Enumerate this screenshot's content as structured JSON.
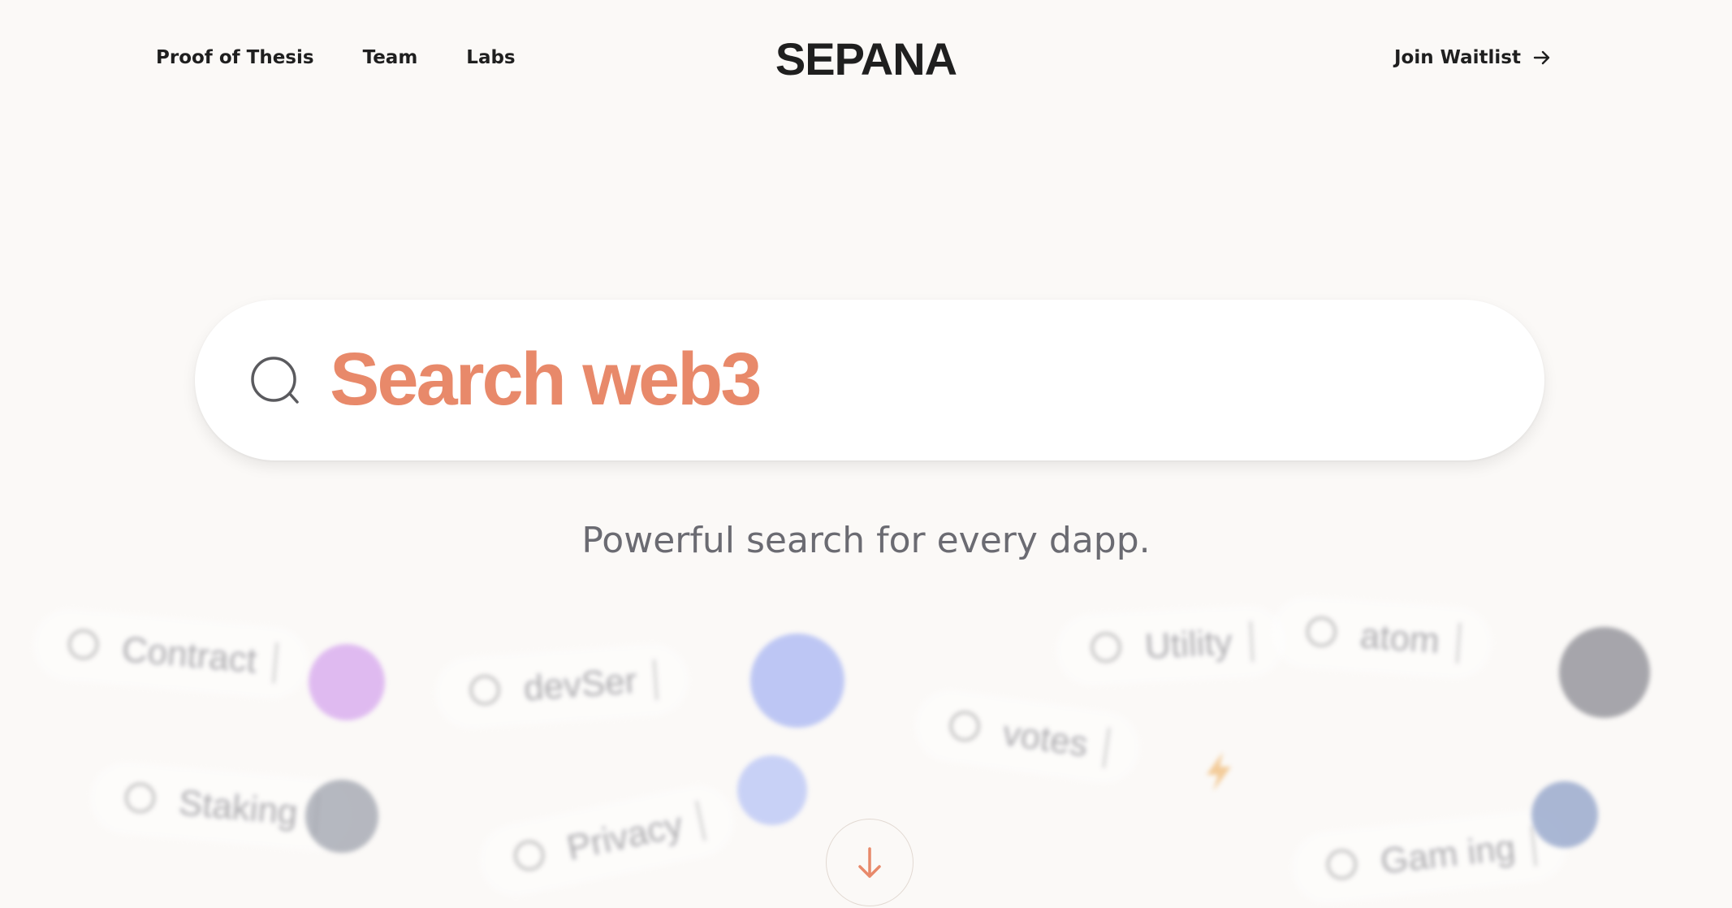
{
  "nav": {
    "links": [
      "Proof of Thesis",
      "Team",
      "Labs"
    ],
    "logo": "SEPANA",
    "cta": "Join Waitlist"
  },
  "hero": {
    "search_placeholder": "Search web3",
    "tagline": "Powerful search for every dapp."
  },
  "background_chips": [
    "Contract",
    "devSer",
    "Utility",
    "atom",
    "votes",
    "Staking",
    "Privacy",
    "Gam ing"
  ],
  "colors": {
    "background": "#fbf9f7",
    "accent": "#e8896a",
    "text": "#1f1f1f",
    "muted": "#6b6b72"
  },
  "icons": {
    "search": "search-icon",
    "cta_arrow": "arrow-right-icon",
    "scroll": "arrow-down-icon"
  }
}
